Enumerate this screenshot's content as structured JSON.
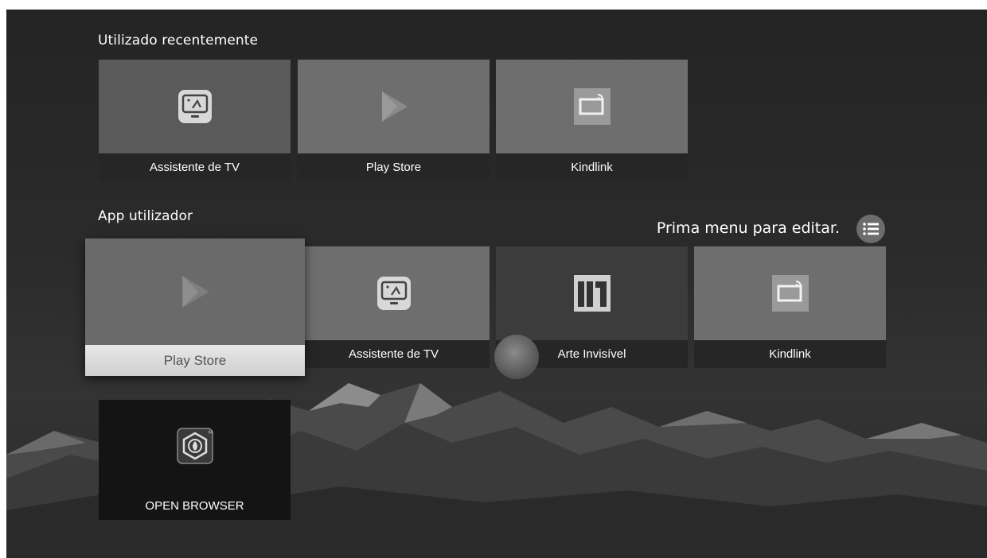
{
  "sections": {
    "recent_title": "Utilizado recentemente",
    "user_title": "App utilizador"
  },
  "recent_apps": [
    {
      "label": "Assistente de TV",
      "icon": "tv-assistant-icon"
    },
    {
      "label": "Play Store",
      "icon": "play-store-icon"
    },
    {
      "label": "Kindlink",
      "icon": "kindlink-cast-icon"
    }
  ],
  "user_apps": [
    {
      "label": "Play Store",
      "icon": "play-store-icon",
      "focused": true
    },
    {
      "label": "Assistente de TV",
      "icon": "tv-assistant-icon"
    },
    {
      "label": "Arte Invisível",
      "icon": "invisible-art-icon"
    },
    {
      "label": "Kindlink",
      "icon": "kindlink-cast-icon"
    },
    {
      "label": "OPEN BROWSER",
      "icon": "open-browser-icon"
    }
  ],
  "hint": {
    "text": "Prima menu para editar.",
    "icon": "menu-list-icon"
  },
  "colors": {
    "focus_label_bg": "#d9d9d9",
    "tile_bg": "#5a5a5a",
    "label_bg": "#262626"
  }
}
